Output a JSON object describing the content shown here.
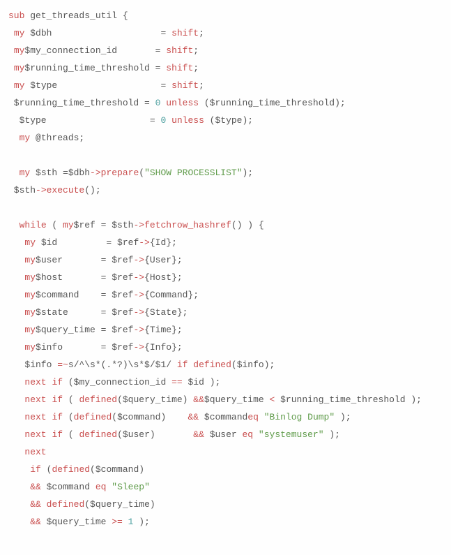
{
  "code": {
    "l01": [
      {
        "t": "sub",
        "c": "kw"
      },
      {
        "t": " get_threads_util {"
      }
    ],
    "l02": [
      {
        "t": " "
      },
      {
        "t": "my",
        "c": "kw"
      },
      {
        "t": " $dbh                    = "
      },
      {
        "t": "shift",
        "c": "kw"
      },
      {
        "t": ";"
      }
    ],
    "l03": [
      {
        "t": " "
      },
      {
        "t": "my",
        "c": "kw"
      },
      {
        "t": "$my_connection_id       = "
      },
      {
        "t": "shift",
        "c": "kw"
      },
      {
        "t": ";"
      }
    ],
    "l04": [
      {
        "t": " "
      },
      {
        "t": "my",
        "c": "kw"
      },
      {
        "t": "$running_time_threshold = "
      },
      {
        "t": "shift",
        "c": "kw"
      },
      {
        "t": ";"
      }
    ],
    "l05": [
      {
        "t": " "
      },
      {
        "t": "my",
        "c": "kw"
      },
      {
        "t": " $type                   = "
      },
      {
        "t": "shift",
        "c": "kw"
      },
      {
        "t": ";"
      }
    ],
    "l06": [
      {
        "t": " $running_time_threshold = "
      },
      {
        "t": "0",
        "c": "num"
      },
      {
        "t": " "
      },
      {
        "t": "unless",
        "c": "kw"
      },
      {
        "t": " ($running_time_threshold);"
      }
    ],
    "l07": [
      {
        "t": "  $type                   = "
      },
      {
        "t": "0",
        "c": "num"
      },
      {
        "t": " "
      },
      {
        "t": "unless",
        "c": "kw"
      },
      {
        "t": " ($type);"
      }
    ],
    "l08": [
      {
        "t": "  "
      },
      {
        "t": "my",
        "c": "kw"
      },
      {
        "t": " @threads;"
      }
    ],
    "l09": [
      {
        "t": " "
      }
    ],
    "l10": [
      {
        "t": "  "
      },
      {
        "t": "my",
        "c": "kw"
      },
      {
        "t": " $sth =$dbh"
      },
      {
        "t": "->",
        "c": "op"
      },
      {
        "t": "prepare",
        "c": "fn"
      },
      {
        "t": "("
      },
      {
        "t": "\"SHOW PROCESSLIST\"",
        "c": "str"
      },
      {
        "t": ");"
      }
    ],
    "l11": [
      {
        "t": " $sth"
      },
      {
        "t": "->",
        "c": "op"
      },
      {
        "t": "execute",
        "c": "fn"
      },
      {
        "t": "();"
      }
    ],
    "l12": [
      {
        "t": " "
      }
    ],
    "l13": [
      {
        "t": "  "
      },
      {
        "t": "while",
        "c": "kw"
      },
      {
        "t": " ( "
      },
      {
        "t": "my",
        "c": "kw"
      },
      {
        "t": "$ref = $sth"
      },
      {
        "t": "->",
        "c": "op"
      },
      {
        "t": "fetchrow_hashref",
        "c": "fn"
      },
      {
        "t": "() ) {"
      }
    ],
    "l14": [
      {
        "t": "   "
      },
      {
        "t": "my",
        "c": "kw"
      },
      {
        "t": " $id         = $ref"
      },
      {
        "t": "->",
        "c": "op"
      },
      {
        "t": "{Id};"
      }
    ],
    "l15": [
      {
        "t": "   "
      },
      {
        "t": "my",
        "c": "kw"
      },
      {
        "t": "$user       = $ref"
      },
      {
        "t": "->",
        "c": "op"
      },
      {
        "t": "{User};"
      }
    ],
    "l16": [
      {
        "t": "   "
      },
      {
        "t": "my",
        "c": "kw"
      },
      {
        "t": "$host       = $ref"
      },
      {
        "t": "->",
        "c": "op"
      },
      {
        "t": "{Host};"
      }
    ],
    "l17": [
      {
        "t": "   "
      },
      {
        "t": "my",
        "c": "kw"
      },
      {
        "t": "$command    = $ref"
      },
      {
        "t": "->",
        "c": "op"
      },
      {
        "t": "{Command};"
      }
    ],
    "l18": [
      {
        "t": "   "
      },
      {
        "t": "my",
        "c": "kw"
      },
      {
        "t": "$state      = $ref"
      },
      {
        "t": "->",
        "c": "op"
      },
      {
        "t": "{State};"
      }
    ],
    "l19": [
      {
        "t": "   "
      },
      {
        "t": "my",
        "c": "kw"
      },
      {
        "t": "$query_time = $ref"
      },
      {
        "t": "->",
        "c": "op"
      },
      {
        "t": "{Time};"
      }
    ],
    "l20": [
      {
        "t": "   "
      },
      {
        "t": "my",
        "c": "kw"
      },
      {
        "t": "$info       = $ref"
      },
      {
        "t": "->",
        "c": "op"
      },
      {
        "t": "{Info};"
      }
    ],
    "l21": [
      {
        "t": "   $info "
      },
      {
        "t": "=~",
        "c": "op"
      },
      {
        "t": "s/^\\s*(.*?)\\s*$/$1/",
        "c": ""
      },
      {
        "t": " "
      },
      {
        "t": "if",
        "c": "kw"
      },
      {
        "t": " "
      },
      {
        "t": "defined",
        "c": "kw"
      },
      {
        "t": "($info);"
      }
    ],
    "l22": [
      {
        "t": "   "
      },
      {
        "t": "next",
        "c": "kw"
      },
      {
        "t": " "
      },
      {
        "t": "if",
        "c": "kw"
      },
      {
        "t": " ($my_connection_id "
      },
      {
        "t": "==",
        "c": "op"
      },
      {
        "t": " $id );"
      }
    ],
    "l23": [
      {
        "t": "   "
      },
      {
        "t": "next",
        "c": "kw"
      },
      {
        "t": " "
      },
      {
        "t": "if",
        "c": "kw"
      },
      {
        "t": " ( "
      },
      {
        "t": "defined",
        "c": "kw"
      },
      {
        "t": "($query_time) "
      },
      {
        "t": "&&",
        "c": "op"
      },
      {
        "t": "$query_time "
      },
      {
        "t": "<",
        "c": "op"
      },
      {
        "t": " $running_time_threshold );"
      }
    ],
    "l24": [
      {
        "t": "   "
      },
      {
        "t": "next",
        "c": "kw"
      },
      {
        "t": " "
      },
      {
        "t": "if",
        "c": "kw"
      },
      {
        "t": " ("
      },
      {
        "t": "defined",
        "c": "kw"
      },
      {
        "t": "($command)    "
      },
      {
        "t": "&&",
        "c": "op"
      },
      {
        "t": " $command"
      },
      {
        "t": "eq",
        "c": "kw"
      },
      {
        "t": " "
      },
      {
        "t": "\"Binlog Dump\"",
        "c": "str"
      },
      {
        "t": " );"
      }
    ],
    "l25": [
      {
        "t": "   "
      },
      {
        "t": "next",
        "c": "kw"
      },
      {
        "t": " "
      },
      {
        "t": "if",
        "c": "kw"
      },
      {
        "t": " ( "
      },
      {
        "t": "defined",
        "c": "kw"
      },
      {
        "t": "($user)       "
      },
      {
        "t": "&&",
        "c": "op"
      },
      {
        "t": " $user "
      },
      {
        "t": "eq",
        "c": "kw"
      },
      {
        "t": " "
      },
      {
        "t": "\"systemuser\"",
        "c": "str"
      },
      {
        "t": " );"
      }
    ],
    "l26": [
      {
        "t": "   "
      },
      {
        "t": "next",
        "c": "kw"
      }
    ],
    "l27": [
      {
        "t": "    "
      },
      {
        "t": "if",
        "c": "kw"
      },
      {
        "t": " ("
      },
      {
        "t": "defined",
        "c": "kw"
      },
      {
        "t": "($command)"
      }
    ],
    "l28": [
      {
        "t": "    "
      },
      {
        "t": "&&",
        "c": "op"
      },
      {
        "t": " $command "
      },
      {
        "t": "eq",
        "c": "kw"
      },
      {
        "t": " "
      },
      {
        "t": "\"Sleep\"",
        "c": "str"
      }
    ],
    "l29": [
      {
        "t": "    "
      },
      {
        "t": "&&",
        "c": "op"
      },
      {
        "t": " "
      },
      {
        "t": "defined",
        "c": "kw"
      },
      {
        "t": "($query_time)"
      }
    ],
    "l30": [
      {
        "t": "    "
      },
      {
        "t": "&&",
        "c": "op"
      },
      {
        "t": " $query_time "
      },
      {
        "t": ">=",
        "c": "op"
      },
      {
        "t": " "
      },
      {
        "t": "1",
        "c": "num"
      },
      {
        "t": " );"
      }
    ]
  },
  "lines": [
    "l01",
    "l02",
    "l03",
    "l04",
    "l05",
    "l06",
    "l07",
    "l08",
    "l09",
    "l10",
    "l11",
    "l12",
    "l13",
    "l14",
    "l15",
    "l16",
    "l17",
    "l18",
    "l19",
    "l20",
    "l21",
    "l22",
    "l23",
    "l24",
    "l25",
    "l26",
    "l27",
    "l28",
    "l29",
    "l30"
  ]
}
